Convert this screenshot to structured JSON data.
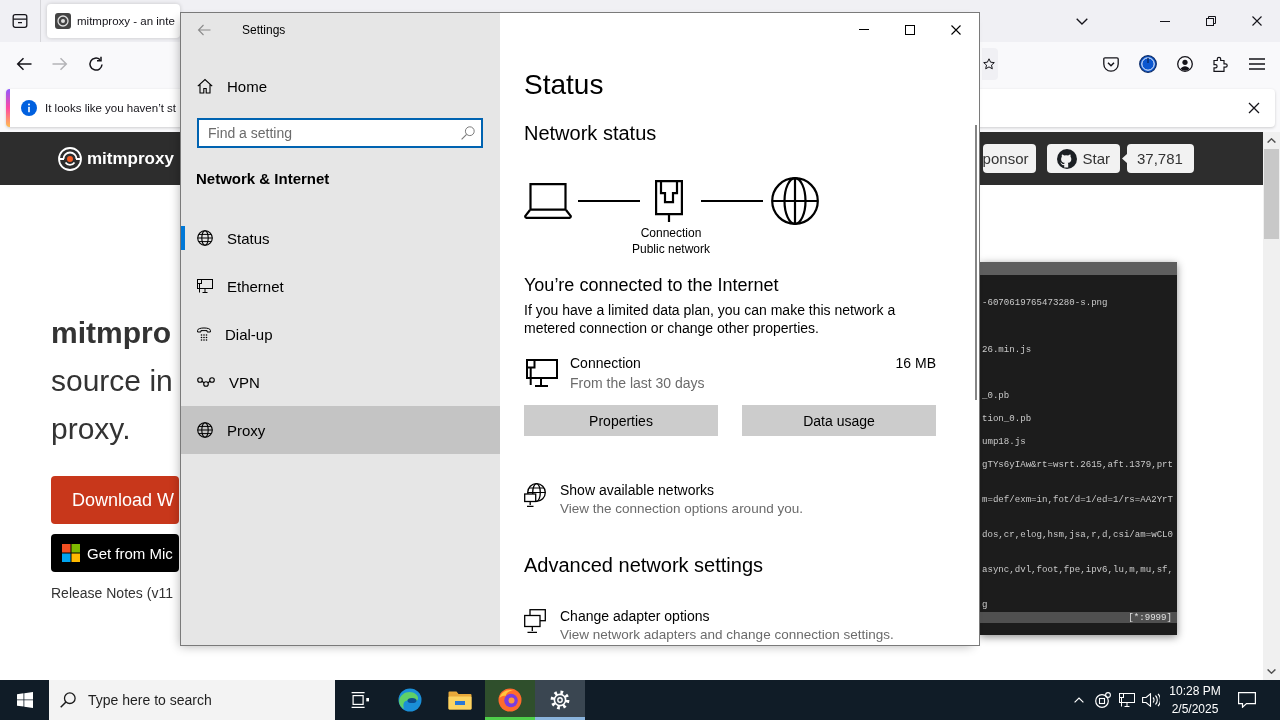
{
  "browser": {
    "tabs": [
      {
        "title": "mitmproxy - an inte",
        "selected": true
      }
    ],
    "nav_buttons": [
      {
        "kind": "back",
        "disabled": false
      },
      {
        "kind": "forward",
        "disabled": true
      },
      {
        "kind": "reload",
        "disabled": false
      }
    ],
    "notification": {
      "text": "It looks like you haven’t st"
    }
  },
  "page": {
    "header": {
      "logo": "mitmproxy",
      "sponsor_button": "ponsor",
      "star_button": "Star",
      "star_count": "37,781"
    },
    "headline": {
      "title": "mitmpro",
      "lines": [
        "source in",
        "proxy."
      ]
    },
    "download_button": "Download W",
    "store_button": "Get from Mic",
    "release_notes": "Release Notes (v11",
    "terminal": {
      "lines": [
        "-6070619765473280-s.png",
        "26.min.js",
        "_0.pb",
        "tion_0.pb",
        "ump18.js",
        "gTYs6yIAw&rt=wsrt.2615,aft.1379,prt",
        "m=def/exm=in,fot/d=1/ed=1/rs=AA2YrT",
        "dos,cr,elog,hsm,jsa,r,d,csi/am=wCL0",
        "async,dvl,foot,fpe,ipv6,lu,m,mu,sf,",
        "g"
      ],
      "status": "[*:9999]"
    }
  },
  "settings": {
    "title": "Settings",
    "home": "Home",
    "search": {
      "placeholder": "Find a setting"
    },
    "section": "Network & Internet",
    "nav": [
      {
        "kind": "status",
        "label": "Status",
        "selected": true,
        "hovered": false
      },
      {
        "kind": "ethernet",
        "label": "Ethernet",
        "selected": false,
        "hovered": false
      },
      {
        "kind": "dialup",
        "label": "Dial-up",
        "selected": false,
        "hovered": false
      },
      {
        "kind": "vpn",
        "label": "VPN",
        "selected": false,
        "hovered": false
      },
      {
        "kind": "proxy",
        "label": "Proxy",
        "selected": false,
        "hovered": true
      }
    ],
    "heading": "Status",
    "network_status": {
      "title": "Network status",
      "labels": [
        "Connection",
        "Public network"
      ]
    },
    "connected_title": "You’re connected to the Internet",
    "connected_text": "If you have a limited data plan, you can make this network a metered connection or change other properties.",
    "connection": {
      "name": "Connection",
      "period": "From the last 30 days",
      "usage": "16 MB"
    },
    "buttons": [
      "Properties",
      "Data usage"
    ],
    "links": [
      {
        "kind": "networks",
        "title": "Show available networks",
        "subtitle": "View the connection options around you."
      }
    ],
    "advanced": {
      "title": "Advanced network settings",
      "links": [
        {
          "kind": "adapter",
          "title": "Change adapter options",
          "subtitle": "View network adapters and change connection settings."
        }
      ]
    }
  },
  "taskbar": {
    "search": {
      "placeholder": "Type here to search"
    },
    "apps": [
      {
        "kind": "task-view",
        "open": false,
        "active": false
      },
      {
        "kind": "edge",
        "open": false,
        "active": false
      },
      {
        "kind": "explorer",
        "open": false,
        "active": false
      },
      {
        "kind": "firefox",
        "open": true,
        "active": false
      },
      {
        "kind": "settings",
        "open": true,
        "active": true
      }
    ],
    "time": "10:28 PM",
    "date": "2/5/2025"
  }
}
